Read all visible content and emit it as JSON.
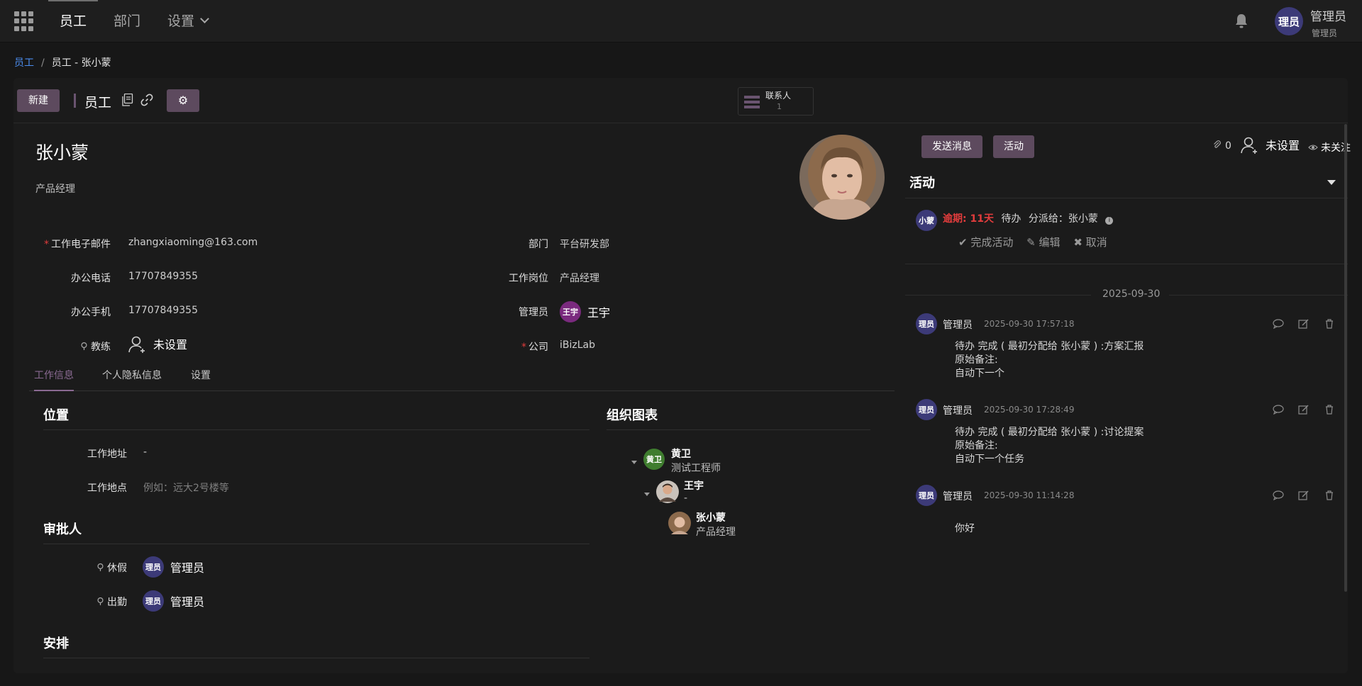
{
  "topbar": {
    "menu": [
      {
        "label": "员工",
        "active": true
      },
      {
        "label": "部门",
        "active": false
      },
      {
        "label": "设置",
        "active": false
      }
    ],
    "user": {
      "avatar": "理员",
      "name": "管理员",
      "sub": "管理员"
    },
    "icons": {
      "apps": "apps-grid-icon",
      "bell": "bell-icon"
    }
  },
  "breadcrumb": {
    "parent": "员工",
    "separator": "/",
    "current": "员工 - 张小蒙"
  },
  "toolbar": {
    "new_label": "新建",
    "title": "员工",
    "gear": "⚙",
    "contacts_label": "联系人",
    "contacts_count": "1"
  },
  "employee": {
    "name": "张小蒙",
    "job_title": "产品经理"
  },
  "fields": {
    "work_email": {
      "label": "工作电子邮件",
      "value": "zhangxiaoming@163.com",
      "required": true
    },
    "work_phone": {
      "label": "办公电话",
      "value": "17707849355"
    },
    "mobile": {
      "label": "办公手机",
      "value": "17707849355"
    },
    "coach": {
      "label": "教练",
      "value": "未设置"
    },
    "department": {
      "label": "部门",
      "value": "平台研发部"
    },
    "job_position": {
      "label": "工作岗位",
      "value": "产品经理"
    },
    "manager": {
      "label": "管理员",
      "avatar": "王宇",
      "value": "王宇"
    },
    "company": {
      "label": "公司",
      "value": "iBizLab",
      "required": true
    }
  },
  "tabs": [
    "工作信息",
    "个人隐私信息",
    "设置"
  ],
  "location": {
    "title": "位置",
    "work_address_label": "工作地址",
    "work_address_value": "-",
    "work_location_label": "工作地点",
    "work_location_placeholder": "例如：远大2号楼等"
  },
  "approvers": {
    "title": "审批人",
    "leave_label": "休假",
    "leave_avatar": "理员",
    "leave_value": "管理员",
    "attendance_label": "出勤",
    "attendance_avatar": "理员",
    "attendance_value": "管理员"
  },
  "schedule": {
    "title": "安排"
  },
  "org_chart": {
    "title": "组织图表",
    "nodes": [
      {
        "avatar": "黄卫",
        "name": "黄卫",
        "job": "测试工程师"
      },
      {
        "name": "王宇",
        "job": "-"
      },
      {
        "name": "张小蒙",
        "job": "产品经理"
      }
    ]
  },
  "chatter": {
    "send_label": "发送消息",
    "activity_label": "活动",
    "attachments": "0",
    "follow_user": "未设置",
    "follow_status": "未关注",
    "activities_title": "活动",
    "activity": {
      "avatar": "小蒙",
      "overdue": "逾期: 11天",
      "type": "待办",
      "assigned": "分派给：张小蒙",
      "done": "完成活动",
      "edit": "编辑",
      "cancel": "取消"
    },
    "date_separator": "2025-09-30",
    "messages": [
      {
        "avatar": "理员",
        "author": "管理员",
        "time": "2025-09-30 17:57:18",
        "lines": [
          "待办 完成 ( 最初分配给 张小蒙 ) :方案汇报",
          "原始备注:",
          "自动下一个"
        ]
      },
      {
        "avatar": "理员",
        "author": "管理员",
        "time": "2025-09-30 17:28:49",
        "lines": [
          "待办 完成 ( 最初分配给 张小蒙 ) :讨论提案",
          "原始备注:",
          "自动下一个任务"
        ]
      },
      {
        "avatar": "理员",
        "author": "管理员",
        "time": "2025-09-30 11:14:28",
        "lines": [
          "你好"
        ]
      }
    ]
  },
  "colors": {
    "accent": "#5d4a5e",
    "link": "#4b8ef0",
    "avatar_bg": "#3c3a78",
    "danger": "#e03c3c",
    "green": "#3f7d2f"
  }
}
